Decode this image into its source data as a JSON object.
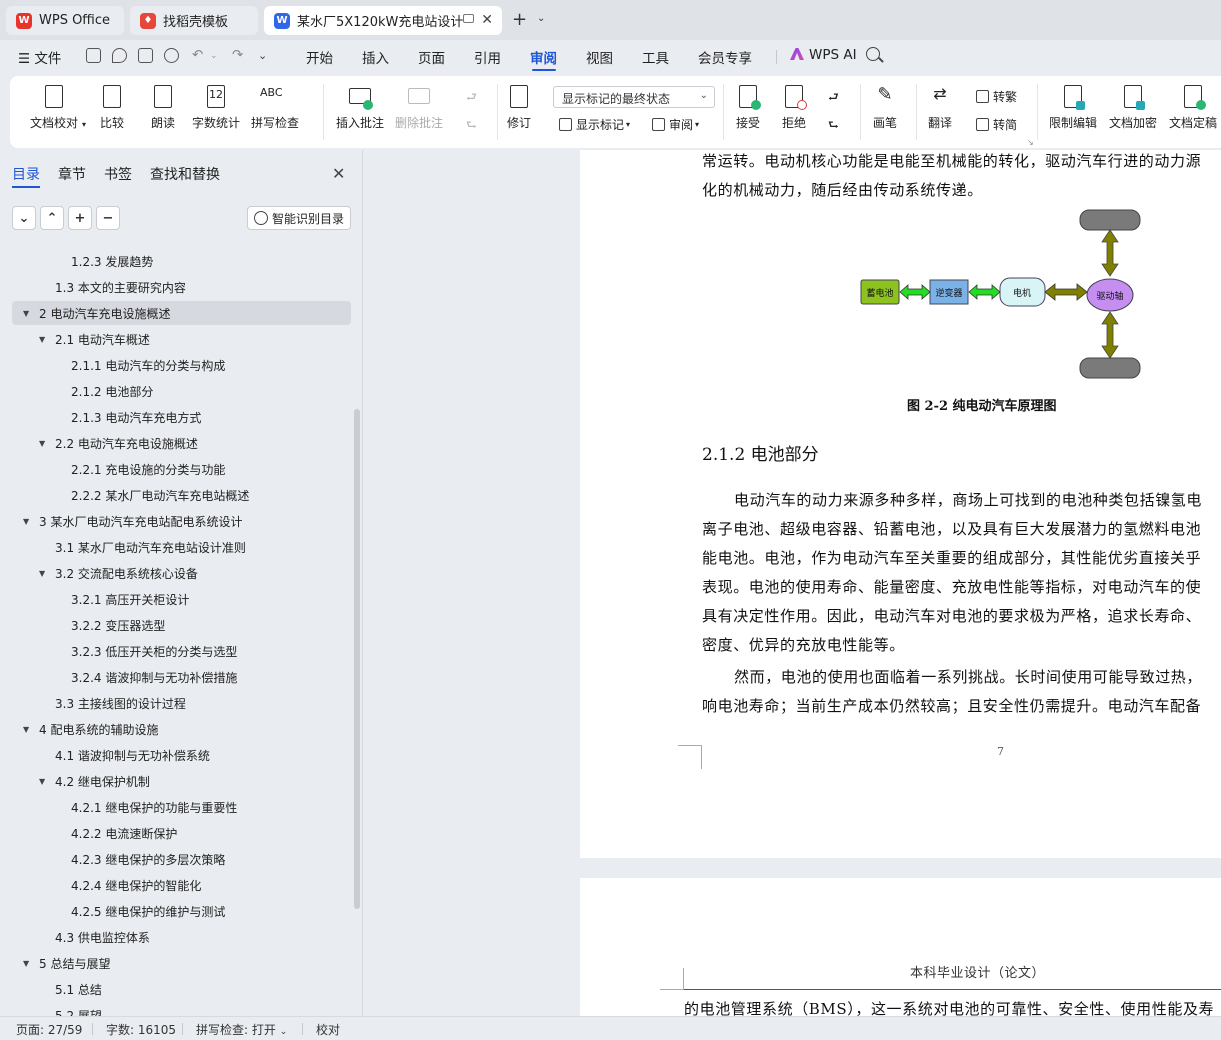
{
  "tabs": {
    "wps_office": "WPS Office",
    "template": "找稻壳模板",
    "document": "某水厂5X120kW充电站设计 ..."
  },
  "menu": {
    "file": "文件",
    "items": [
      "开始",
      "插入",
      "页面",
      "引用",
      "审阅",
      "视图",
      "工具",
      "会员专享"
    ],
    "active": "审阅",
    "ai": "WPS AI"
  },
  "ribbon": {
    "proofread": "文档校对",
    "compare": "比较",
    "read_aloud": "朗读",
    "word_count": "字数统计",
    "spell_check": "拼写检查",
    "insert_comment": "插入批注",
    "delete_comment": "删除批注",
    "track_changes": "修订",
    "markup_state": "显示标记的最终状态",
    "show_markup": "显示标记",
    "review": "审阅",
    "accept": "接受",
    "reject": "拒绝",
    "ink": "画笔",
    "translate": "翻译",
    "to_traditional": "转繁",
    "to_simplified": "转简",
    "restrict_edit": "限制编辑",
    "encrypt": "文档加密",
    "finalize": "文档定稿",
    "word_count_icon_text": "12",
    "spell_icon_text": "ABC"
  },
  "nav": {
    "tabs": [
      "目录",
      "章节",
      "书签",
      "查找和替换"
    ],
    "smart_toc": "智能识别目录",
    "items": [
      {
        "level": 3,
        "text": "1.2.3  发展趋势"
      },
      {
        "level": 2,
        "text": "1.3 本文的主要研究内容"
      },
      {
        "level": 1,
        "text": "2  电动汽车充电设施概述",
        "expanded": true,
        "selected": true
      },
      {
        "level": 2,
        "text": "2.1  电动汽车概述",
        "expanded": true
      },
      {
        "level": 3,
        "text": "2.1.1  电动汽车的分类与构成"
      },
      {
        "level": 3,
        "text": "2.1.2  电池部分"
      },
      {
        "level": 3,
        "text": "2.1.3  电动汽车充电方式"
      },
      {
        "level": 2,
        "text": "2.2  电动汽车充电设施概述",
        "expanded": true
      },
      {
        "level": 3,
        "text": "2.2.1  充电设施的分类与功能"
      },
      {
        "level": 3,
        "text": "2.2.2  某水厂电动汽车充电站概述"
      },
      {
        "level": 1,
        "text": "3  某水厂电动汽车充电站配电系统设计",
        "expanded": true
      },
      {
        "level": 2,
        "text": "3.1  某水厂电动汽车充电站设计准则"
      },
      {
        "level": 2,
        "text": "3.2  交流配电系统核心设备",
        "expanded": true
      },
      {
        "level": 3,
        "text": "3.2.1  高压开关柜设计"
      },
      {
        "level": 3,
        "text": "3.2.2  变压器选型"
      },
      {
        "level": 3,
        "text": "3.2.3  低压开关柜的分类与选型"
      },
      {
        "level": 3,
        "text": "3.2.4  谐波抑制与无功补偿措施"
      },
      {
        "level": 2,
        "text": "3.3  主接线图的设计过程"
      },
      {
        "level": 1,
        "text": "4  配电系统的辅助设施",
        "expanded": true
      },
      {
        "level": 2,
        "text": "4.1  谐波抑制与无功补偿系统"
      },
      {
        "level": 2,
        "text": "4.2  继电保护机制",
        "expanded": true
      },
      {
        "level": 3,
        "text": "4.2.1  继电保护的功能与重要性"
      },
      {
        "level": 3,
        "text": "4.2.2  电流速断保护"
      },
      {
        "level": 3,
        "text": "4.2.3  继电保护的多层次策略"
      },
      {
        "level": 3,
        "text": "4.2.4  继电保护的智能化"
      },
      {
        "level": 3,
        "text": "4.2.5  继电保护的维护与测试"
      },
      {
        "level": 2,
        "text": "4.3  供电监控体系"
      },
      {
        "level": 1,
        "text": "5  总结与展望",
        "expanded": true
      },
      {
        "level": 2,
        "text": "5.1  总结"
      },
      {
        "level": 2,
        "text": "5.2  展望"
      }
    ]
  },
  "document": {
    "page1_lines_top": [
      "常运转。电动机核心功能是电能至机械能的转化，驱动汽车行进的动力源",
      "化的机械动力，随后经由传动系统传递。"
    ],
    "diagram": {
      "battery": "蓄电池",
      "inverter": "逆变器",
      "motor": "电机",
      "drive_shaft": "驱动轴"
    },
    "figure_caption": "图 2-2  纯电动汽车原理图",
    "heading": "2.1.2  电池部分",
    "paragraph1": [
      "电动汽车的动力来源多种多样，商场上可找到的电池种类包括镍氢电",
      "离子电池、超级电容器、铅蓄电池，以及具有巨大发展潜力的氢燃料电池",
      "能电池。电池，作为电动汽车至关重要的组成部分，其性能优劣直接关乎",
      "表现。电池的使用寿命、能量密度、充放电性能等指标，对电动汽车的使",
      "具有决定性作用。因此，电动汽车对电池的要求极为严格，追求长寿命、",
      "密度、优异的充放电性能等。"
    ],
    "paragraph2": [
      "然而，电池的使用也面临着一系列挑战。长时间使用可能导致过热，",
      "响电池寿命；当前生产成本仍然较高；且安全性仍需提升。电动汽车配备"
    ],
    "page_number": "7",
    "page2_header": "本科毕业设计（论文）",
    "page2_line": "的电池管理系统（BMS），这一系统对电池的可靠性、安全性、使用性能及寿"
  },
  "status": {
    "page": "页面: 27/59",
    "words": "字数: 16105",
    "spell": "拼写检查: 打开",
    "proof": "校对"
  },
  "colors": {
    "accent": "#1f56d8",
    "battery_fill": "#8dc21f",
    "inverter_fill": "#7ab2e8",
    "motor_fill": "#d8f4f7",
    "shaft_fill": "#c58ef0",
    "arrow_green": "#22dd22",
    "arrow_olive": "#808000"
  }
}
